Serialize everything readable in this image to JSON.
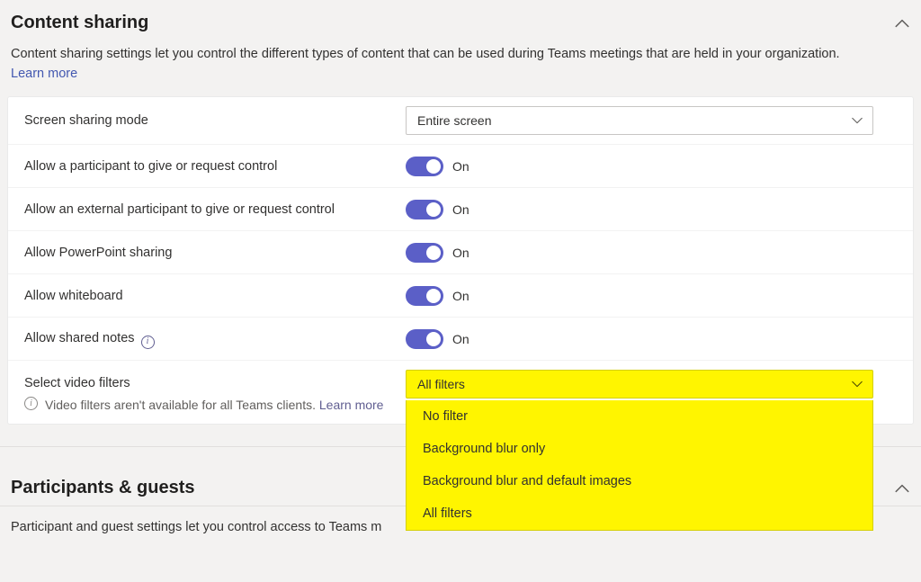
{
  "section_content_sharing": {
    "title": "Content sharing",
    "description": "Content sharing settings let you control the different types of content that can be used during Teams meetings that are held in your organization.",
    "learn_more": "Learn more"
  },
  "rows": {
    "screen_sharing_mode": {
      "label": "Screen sharing mode",
      "value": "Entire screen"
    },
    "allow_participant_control": {
      "label": "Allow a participant to give or request control",
      "state": "On"
    },
    "allow_external_control": {
      "label": "Allow an external participant to give or request control",
      "state": "On"
    },
    "allow_powerpoint": {
      "label": "Allow PowerPoint sharing",
      "state": "On"
    },
    "allow_whiteboard": {
      "label": "Allow whiteboard",
      "state": "On"
    },
    "allow_shared_notes": {
      "label": "Allow shared notes",
      "state": "On"
    },
    "select_video_filters": {
      "label": "Select video filters",
      "hint": "Video filters aren't available for all Teams clients.",
      "learn_more": "Learn more",
      "selected": "All filters",
      "options": [
        "No filter",
        "Background blur only",
        "Background blur and default images",
        "All filters"
      ]
    }
  },
  "section_participants": {
    "title": "Participants & guests",
    "description_visible": "Participant and guest settings let you control access to Teams m"
  }
}
